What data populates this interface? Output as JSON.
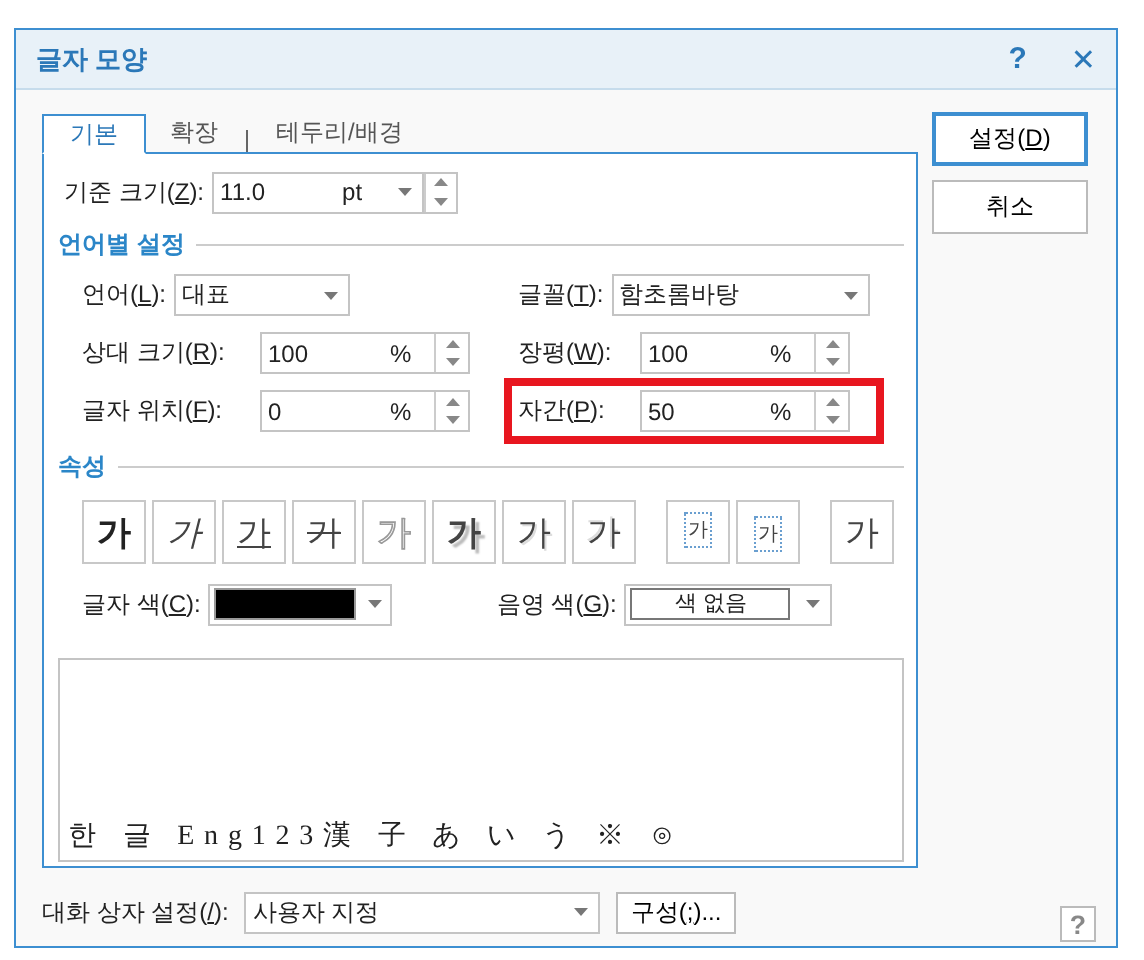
{
  "window": {
    "title": "글자 모양",
    "help": "?",
    "close": "✕"
  },
  "tabs": [
    {
      "label": "기본",
      "selected": true
    },
    {
      "label": "확장",
      "selected": false
    },
    {
      "label": "테두리/배경",
      "selected": false
    }
  ],
  "base_size": {
    "before": "기준 크기(",
    "key": "Z",
    "after": "):",
    "value": "11.0",
    "unit": "pt"
  },
  "language_section": {
    "title": "언어별 설정",
    "rows": [
      [
        {
          "kind": "combo",
          "before": "언어(",
          "key": "L",
          "after": "):",
          "value": "대표",
          "highlighted": false
        },
        {
          "kind": "combo",
          "before": "글꼴(",
          "key": "T",
          "after": "):",
          "value": "함초롬바탕",
          "highlighted": false
        }
      ],
      [
        {
          "kind": "spin",
          "before": "상대 크기(",
          "key": "R",
          "after": "):",
          "value": "100",
          "unit": "%",
          "highlighted": false
        },
        {
          "kind": "spin",
          "before": "장평(",
          "key": "W",
          "after": "):",
          "value": "100",
          "unit": "%",
          "highlighted": false
        }
      ],
      [
        {
          "kind": "spin",
          "before": "글자 위치(",
          "key": "F",
          "after": "):",
          "value": "0",
          "unit": "%",
          "highlighted": false
        },
        {
          "kind": "spin",
          "before": "자간(",
          "key": "P",
          "after": "):",
          "value": "50",
          "unit": "%",
          "highlighted": true
        }
      ]
    ]
  },
  "attributes_section": {
    "title": "속성",
    "buttons": [
      {
        "kind": "bold",
        "glyph": "가"
      },
      {
        "kind": "italic",
        "glyph": "가"
      },
      {
        "kind": "underline",
        "glyph": "가"
      },
      {
        "kind": "strike",
        "glyph": "가"
      },
      {
        "kind": "outline",
        "glyph": "가"
      },
      {
        "kind": "shadow",
        "glyph": "가"
      },
      {
        "kind": "emboss",
        "glyph": "가"
      },
      {
        "kind": "engrave",
        "glyph": "가"
      },
      {
        "kind": "superscript",
        "glyph": "가"
      },
      {
        "kind": "subscript",
        "glyph": "가"
      },
      {
        "kind": "normal",
        "glyph": "가"
      }
    ],
    "text_color": {
      "before": "글자 색(",
      "key": "C",
      "after": "):",
      "color": "#000000"
    },
    "shade_color": {
      "before": "음영 색(",
      "key": "G",
      "after": "):",
      "value": "색 없음"
    }
  },
  "preview": {
    "text": "한 글 Eng123漢 子 あ い う ※ ⊙"
  },
  "footer": {
    "before": "대화 상자 설정(",
    "key": "/",
    "after": "):",
    "value": "사용자 지정",
    "configure": {
      "before": "구성(",
      "key": ";",
      "after": ")..."
    },
    "help": "?"
  },
  "buttons": [
    {
      "before": "설정(",
      "key": "D",
      "after": ")",
      "default": true
    },
    {
      "label": "취소",
      "default": false
    }
  ]
}
